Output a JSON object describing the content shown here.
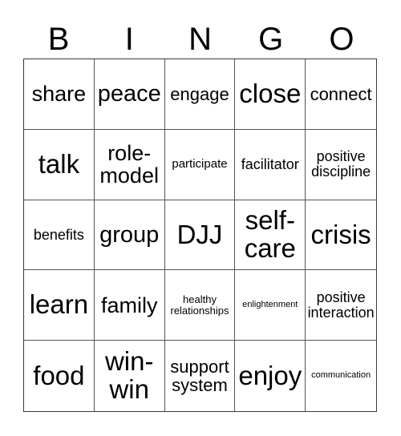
{
  "header": {
    "letters": [
      "B",
      "I",
      "N",
      "G",
      "O"
    ]
  },
  "cells": [
    "share",
    "peace",
    "engage",
    "close",
    "connect",
    "talk",
    "role-model",
    "participate",
    "facilitator",
    "positive discipline",
    "benefits",
    "group",
    "DJJ",
    "self-care",
    "crisis",
    "learn",
    "family",
    "healthy relationships",
    "enlightenment",
    "positive interaction",
    "food",
    "win-win",
    "support system",
    "enjoy",
    "communication"
  ]
}
